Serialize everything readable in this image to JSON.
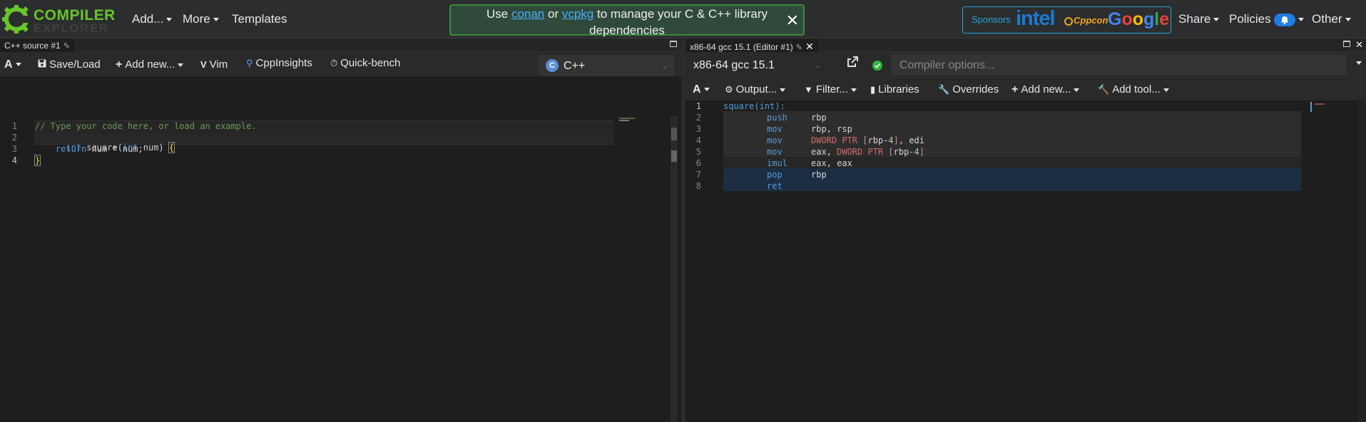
{
  "navbar": {
    "logo_line1": "COMPILER",
    "logo_line2": "EXPLORER",
    "add": "Add...",
    "more": "More",
    "templates": "Templates",
    "alert": {
      "pre": "Use ",
      "link1": "conan",
      "mid": " or ",
      "link2": "vcpkg",
      "post": " to manage your C & C++ library dependencies",
      "close": "✕"
    },
    "sponsors": {
      "label": "Sponsors",
      "s1": "intel",
      "s2": "Cppcon",
      "s3": "Google"
    },
    "share": "Share",
    "policies": "Policies",
    "other": "Other"
  },
  "left_pane": {
    "tab_title": "C++ source #1",
    "toolbar": {
      "font": "A",
      "save_load": "Save/Load",
      "add_new": "Add new...",
      "vim": "Vim",
      "cppinsights": "CppInsights",
      "quickbench": "Quick-bench"
    },
    "language": "C++",
    "lines": [
      {
        "num": "1",
        "text": "// Type your code here, or load an example."
      },
      {
        "num": "2",
        "text": "int square(int num) {"
      },
      {
        "num": "3",
        "text": "    return num * num;"
      },
      {
        "num": "4",
        "text": "}"
      }
    ]
  },
  "right_pane": {
    "tab_title": "x86-64 gcc 15.1 (Editor #1)",
    "compiler": "x86-64 gcc 15.1",
    "options_placeholder": "Compiler options...",
    "toolbar": {
      "font": "A",
      "output": "Output...",
      "filter": "Filter...",
      "libraries": "Libraries",
      "overrides": "Overrides",
      "add_new": "Add new...",
      "add_tool": "Add tool..."
    },
    "asm": [
      {
        "num": "1",
        "label": "square(int):"
      },
      {
        "num": "2",
        "op": "push",
        "args": "rbp"
      },
      {
        "num": "3",
        "op": "mov",
        "args": "rbp, rsp"
      },
      {
        "num": "4",
        "op": "mov",
        "args": "DWORD PTR [rbp-4], edi"
      },
      {
        "num": "5",
        "op": "mov",
        "args": "eax, DWORD PTR [rbp-4]"
      },
      {
        "num": "6",
        "op": "imul",
        "args": "eax, eax"
      },
      {
        "num": "7",
        "op": "pop",
        "args": "rbp"
      },
      {
        "num": "8",
        "op": "ret",
        "args": ""
      }
    ]
  }
}
